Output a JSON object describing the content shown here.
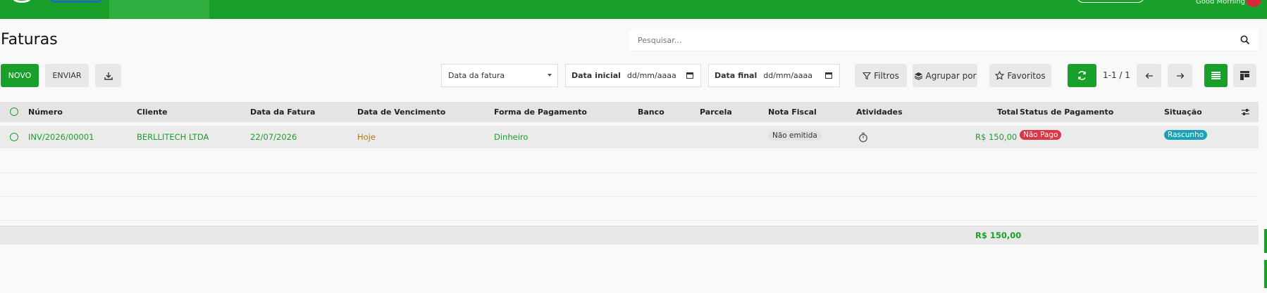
{
  "header": {
    "user_name": "Good Morning"
  },
  "page": {
    "title": "Faturas"
  },
  "search": {
    "placeholder": "Pesquisar..."
  },
  "toolbar": {
    "new_label": "NOVO",
    "send_label": "ENVIAR",
    "date_field_selected": "Data da fatura",
    "start_date_label": "Data inicial",
    "start_date_value": "dd/mm/aaaa",
    "end_date_label": "Data final",
    "end_date_value": "dd/mm/aaaa",
    "filters_label": "Filtros",
    "group_by_label": "Agrupar por",
    "favorites_label": "Favoritos",
    "pager": "1-1 / 1"
  },
  "table": {
    "columns": [
      "Número",
      "Cliente",
      "Data da Fatura",
      "Data de Vencimento",
      "Forma de Pagamento",
      "Banco",
      "Parcela",
      "Nota Fiscal",
      "Atividades",
      "Total",
      "Status de Pagamento",
      "Situação"
    ],
    "rows": [
      {
        "numero": "INV/2026/00001",
        "cliente": "BERLLITECH LTDA",
        "data_fatura": "22/07/2026",
        "data_vencimento": "Hoje",
        "forma_pagamento": "Dinheiro",
        "banco": "",
        "parcela": "",
        "nota_fiscal": "Não emitida",
        "total": "R$ 150,00",
        "status_pagamento": "Não Pago",
        "situacao": "Rascunho"
      }
    ],
    "footer_total": "R$ 150,00"
  },
  "colors": {
    "brand": "#18a02a",
    "danger": "#dc3545",
    "info": "#17a2b8",
    "warning_text": "#b0780a"
  }
}
